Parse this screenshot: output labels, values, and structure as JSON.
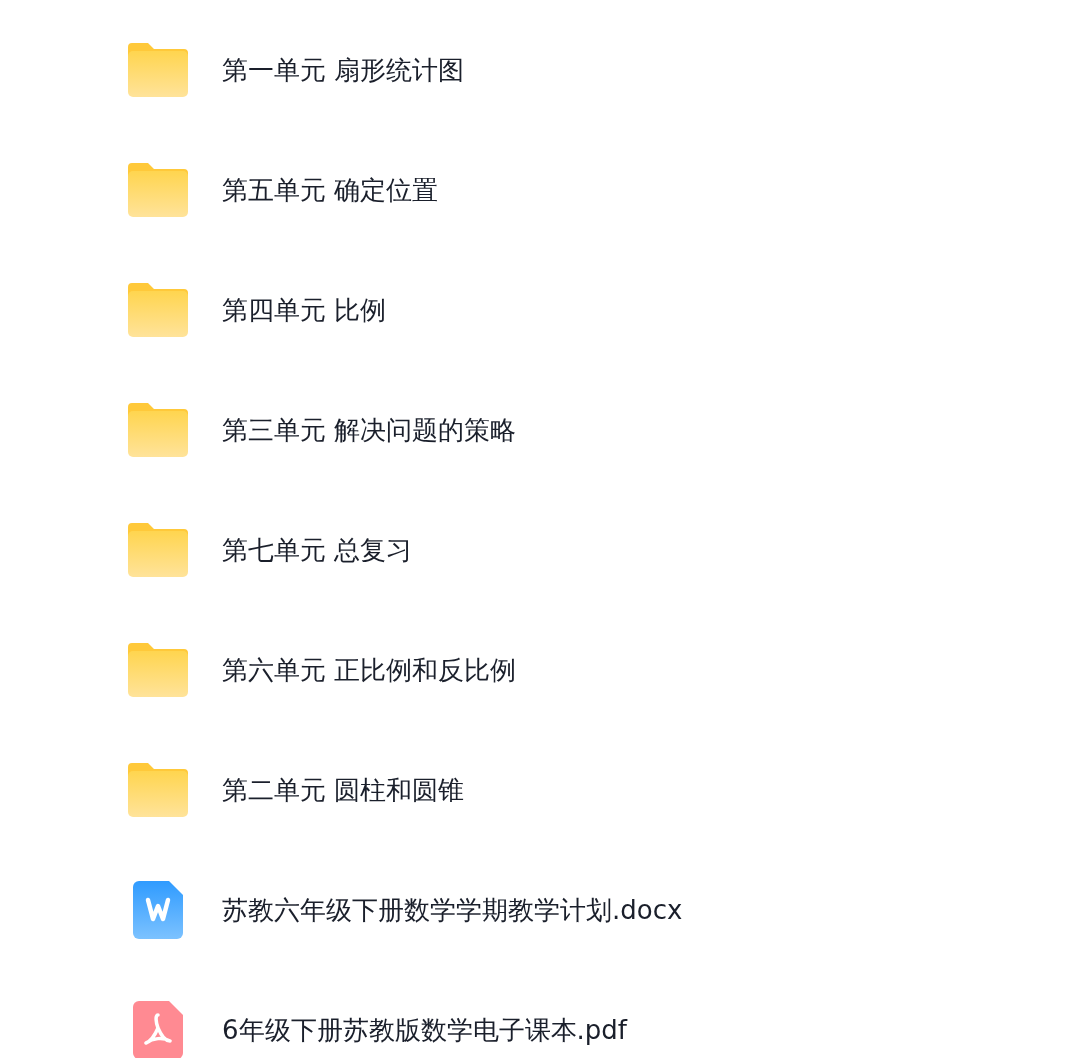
{
  "files": [
    {
      "kind": "folder",
      "name": "第一单元 扇形统计图"
    },
    {
      "kind": "folder",
      "name": "第五单元 确定位置"
    },
    {
      "kind": "folder",
      "name": "第四单元 比例"
    },
    {
      "kind": "folder",
      "name": "第三单元 解决问题的策略"
    },
    {
      "kind": "folder",
      "name": "第七单元 总复习"
    },
    {
      "kind": "folder",
      "name": "第六单元 正比例和反比例"
    },
    {
      "kind": "folder",
      "name": "第二单元 圆柱和圆锥"
    },
    {
      "kind": "word",
      "name": "苏教六年级下册数学学期教学计划.docx"
    },
    {
      "kind": "pdf",
      "name": "6年级下册苏教版数学电子课本.pdf"
    }
  ]
}
